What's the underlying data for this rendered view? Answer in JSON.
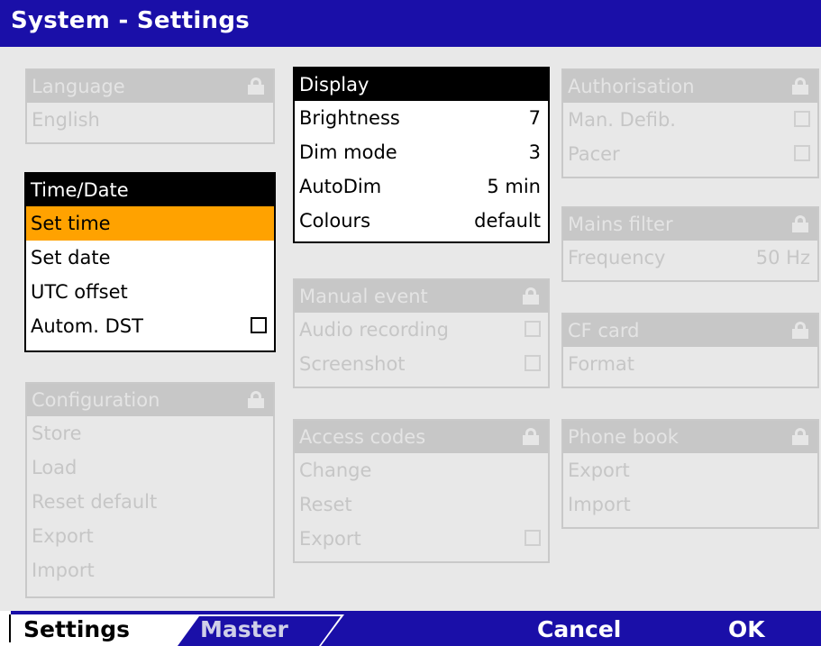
{
  "title": "System - Settings",
  "panels": {
    "language": {
      "header": "Language",
      "value": "English"
    },
    "timedate": {
      "header": "Time/Date",
      "rows": [
        "Set time",
        "Set date",
        "UTC offset",
        "Autom. DST"
      ]
    },
    "configuration": {
      "header": "Configuration",
      "rows": [
        "Store",
        "Load",
        "Reset default",
        "Export",
        "Import"
      ]
    },
    "display": {
      "header": "Display",
      "rows": [
        {
          "label": "Brightness",
          "value": "7"
        },
        {
          "label": "Dim mode",
          "value": "3"
        },
        {
          "label": "AutoDim",
          "value": "5 min"
        },
        {
          "label": "Colours",
          "value": "default"
        }
      ]
    },
    "manual_event": {
      "header": "Manual event",
      "rows": [
        "Audio recording",
        "Screenshot"
      ]
    },
    "access_codes": {
      "header": "Access codes",
      "rows": [
        "Change",
        "Reset",
        "Export"
      ]
    },
    "authorisation": {
      "header": "Authorisation",
      "rows": [
        "Man. Defib.",
        "Pacer"
      ]
    },
    "mains_filter": {
      "header": "Mains filter",
      "label": "Frequency",
      "value": "50 Hz"
    },
    "cf_card": {
      "header": "CF card",
      "rows": [
        "Format"
      ]
    },
    "phone_book": {
      "header": "Phone book",
      "rows": [
        "Export",
        "Import"
      ]
    }
  },
  "bottom": {
    "tabs": [
      "Settings",
      "Master"
    ],
    "cancel": "Cancel",
    "ok": "OK"
  },
  "colors": {
    "titlebar": "#1a0fa8",
    "selection": "#ffa200",
    "disabled_header": "#c7c7c7",
    "background": "#e8e8e8"
  },
  "icons": {
    "panel_lock": "lock-icon",
    "checkbox": "checkbox-icon"
  }
}
